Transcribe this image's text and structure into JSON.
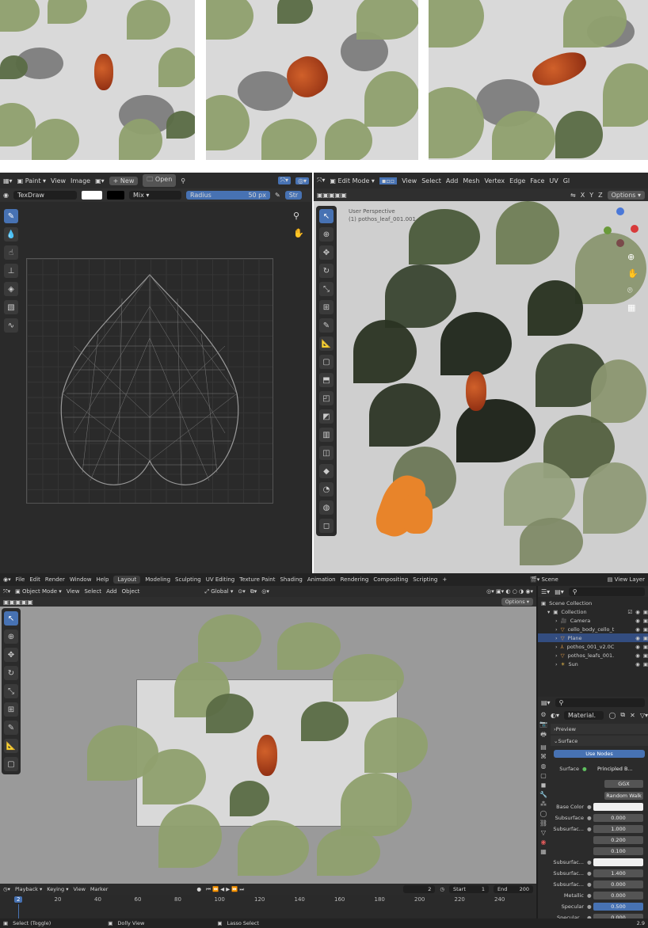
{
  "uv_editor": {
    "header": {
      "mode": "Paint",
      "menu_view": "View",
      "menu_image": "Image",
      "new_label": "New",
      "open_label": "Open"
    },
    "tool_header": {
      "brush": "TexDraw",
      "blend": "Mix",
      "radius_label": "Radius",
      "radius_value": "50 px",
      "strength_label": "Str"
    }
  },
  "viewport_edit": {
    "header": {
      "mode": "Edit Mode",
      "menus": [
        "View",
        "Select",
        "Add",
        "Mesh",
        "Vertex",
        "Edge",
        "Face",
        "UV"
      ],
      "extra": "Gl"
    },
    "axes": [
      "X",
      "Y",
      "Z"
    ],
    "options_label": "Options",
    "overlay_line1": "User Perspective",
    "overlay_line2": "(1) pothos_leaf_001.001"
  },
  "topbar": {
    "menus": [
      "File",
      "Edit",
      "Render",
      "Window",
      "Help"
    ],
    "workspaces": [
      "Layout",
      "Modeling",
      "Sculpting",
      "UV Editing",
      "Texture Paint",
      "Shading",
      "Animation",
      "Rendering",
      "Compositing",
      "Scripting"
    ],
    "active_workspace": "Layout",
    "add_tab": "+",
    "scene": "Scene",
    "view_layer": "View Layer"
  },
  "viewport_object": {
    "header": {
      "mode": "Object Mode",
      "menus": [
        "View",
        "Select",
        "Add",
        "Object"
      ],
      "transform": "Global"
    },
    "options_label": "Options"
  },
  "outliner": {
    "root": "Scene Collection",
    "collection": "Collection",
    "items": [
      {
        "name": "Camera",
        "color": "#e09a4a"
      },
      {
        "name": "cello_body_cello_t",
        "color": "#e09a4a"
      },
      {
        "name": "Plane",
        "color": "#e09a4a"
      },
      {
        "name": "pothos_001_v2.0C",
        "color": "#e09a4a"
      },
      {
        "name": "pothos_leafs_001.",
        "color": "#e09a4a"
      },
      {
        "name": "Sun",
        "color": "#e0b44a"
      }
    ],
    "selected_index": 2
  },
  "properties": {
    "material_name": "Material.",
    "sections": {
      "preview": "Preview",
      "surface": "Surface"
    },
    "use_nodes": "Use Nodes",
    "surface_label": "Surface",
    "surface_value": "Principled B...",
    "distribution": "GGX",
    "subsurface_method": "Random Walk",
    "rows": [
      {
        "label": "Base Color",
        "value": ""
      },
      {
        "label": "Subsurface",
        "value": "0.000"
      },
      {
        "label": "Subsurfac...",
        "value": "1.000"
      },
      {
        "label": "",
        "value": "0.200"
      },
      {
        "label": "",
        "value": "0.100"
      },
      {
        "label": "Subsurfac...",
        "value": ""
      },
      {
        "label": "Subsurfac...",
        "value": "1.400"
      },
      {
        "label": "Subsurfac...",
        "value": "0.000"
      },
      {
        "label": "Metallic",
        "value": "0.000"
      },
      {
        "label": "Specular",
        "value": "0.500"
      },
      {
        "label": "Specular...",
        "value": "0.000"
      }
    ]
  },
  "timeline": {
    "menus": [
      "Playback",
      "Keying",
      "View",
      "Marker"
    ],
    "current_frame": "2",
    "start_label": "Start",
    "start_value": "1",
    "end_label": "End",
    "end_value": "200",
    "ticks": [
      "2",
      "20",
      "40",
      "60",
      "80",
      "100",
      "120",
      "140",
      "160",
      "180",
      "200",
      "220",
      "240"
    ]
  },
  "statusbar": {
    "left": "Select (Toggle)",
    "middle": "Dolly View",
    "right": "Lasso Select",
    "version": "2.9"
  }
}
